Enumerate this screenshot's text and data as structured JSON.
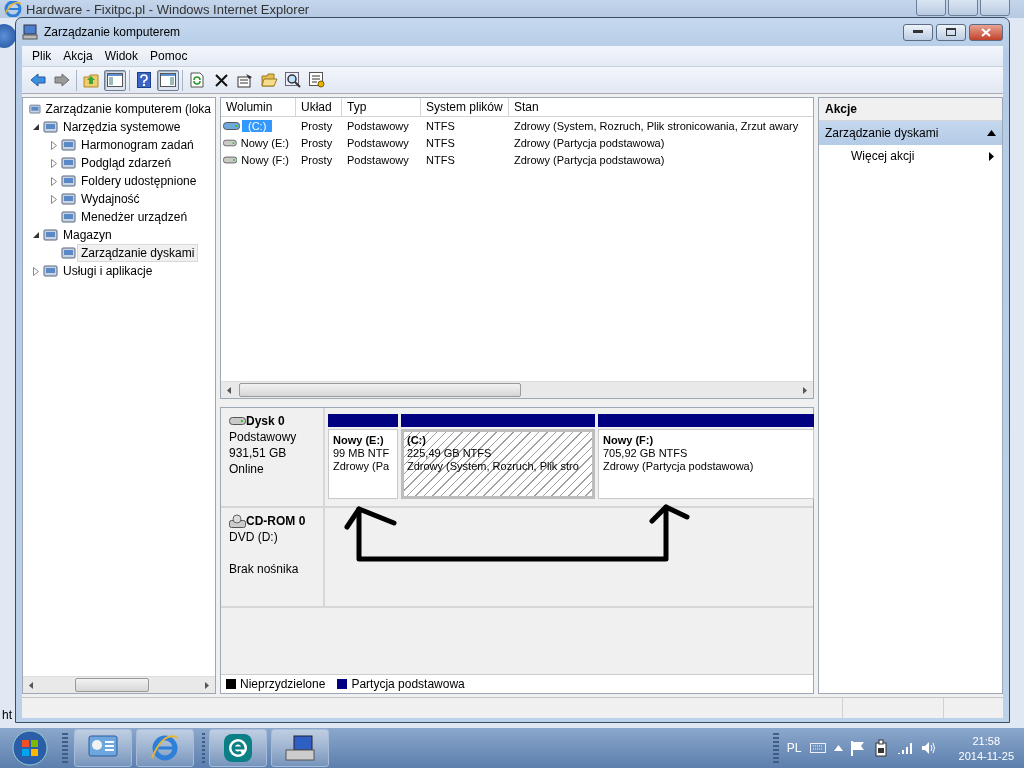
{
  "browser": {
    "title": "Hardware - Fixitpc.pl - Windows Internet Explorer",
    "status_text": "ht"
  },
  "window": {
    "title": "Zarządzanie komputerem"
  },
  "menu": [
    "Plik",
    "Akcja",
    "Widok",
    "Pomoc"
  ],
  "toolbar_groups": [
    {
      "buttons": [
        {
          "kind": "back",
          "pressed": false
        },
        {
          "kind": "forward",
          "pressed": false
        }
      ]
    },
    {
      "buttons": [
        {
          "kind": "up",
          "pressed": false
        },
        {
          "kind": "tree-pane",
          "pressed": true
        }
      ]
    },
    {
      "buttons": [
        {
          "kind": "help",
          "pressed": false
        },
        {
          "kind": "action-pane",
          "pressed": true
        }
      ]
    },
    {
      "buttons": [
        {
          "kind": "refresh",
          "pressed": false
        },
        {
          "kind": "delete",
          "pressed": false
        },
        {
          "kind": "properties",
          "pressed": false
        },
        {
          "kind": "open",
          "pressed": false
        },
        {
          "kind": "search",
          "pressed": false
        },
        {
          "kind": "settings",
          "pressed": false
        }
      ]
    }
  ],
  "tree": [
    {
      "label": "Zarządzanie komputerem (loka",
      "selected": false,
      "children": [
        {
          "label": "Narzędzia systemowe",
          "expanded": true,
          "selected": false,
          "children": [
            {
              "label": "Harmonogram zadań",
              "expanded": false,
              "selected": false
            },
            {
              "label": "Podgląd zdarzeń",
              "expanded": false,
              "selected": false
            },
            {
              "label": "Foldery udostępnione",
              "expanded": false,
              "selected": false
            },
            {
              "label": "Wydajność",
              "expanded": false,
              "selected": false
            },
            {
              "label": "Menedżer urządzeń",
              "selected": false
            }
          ]
        },
        {
          "label": "Magazyn",
          "expanded": true,
          "selected": false,
          "children": [
            {
              "label": "Zarządzanie dyskami",
              "selected": true
            }
          ]
        },
        {
          "label": "Usługi i aplikacje",
          "expanded": false,
          "selected": false
        }
      ]
    }
  ],
  "table": {
    "columns": [
      "Wolumin",
      "Układ",
      "Typ",
      "System plików",
      "Stan"
    ],
    "rows": [
      {
        "cells": [
          "(C:)",
          "Prosty",
          "Podstawowy",
          "NTFS",
          "Zdrowy (System, Rozruch, Plik stronicowania, Zrzut awary"
        ],
        "selected": true,
        "system": true
      },
      {
        "cells": [
          "Nowy (E:)",
          "Prosty",
          "Podstawowy",
          "NTFS",
          "Zdrowy (Partycja podstawowa)"
        ],
        "selected": false,
        "system": false
      },
      {
        "cells": [
          "Nowy (F:)",
          "Prosty",
          "Podstawowy",
          "NTFS",
          "Zdrowy (Partycja podstawowa)"
        ],
        "selected": false,
        "system": false
      }
    ]
  },
  "disks": [
    {
      "kind": "disk",
      "name": "Dysk 0",
      "lines": [
        "Podstawowy",
        "931,51 GB",
        "Online"
      ],
      "partitions": [
        {
          "name": "Nowy  (E:)",
          "size": "99 MB NTF",
          "status": "Zdrowy (Pa",
          "selected": false
        },
        {
          "name": "(C:)",
          "size": "225,49 GB NTFS",
          "status": "Zdrowy (System, Rozruch, Plik stro",
          "selected": true
        },
        {
          "name": "Nowy  (F:)",
          "size": "705,92 GB NTFS",
          "status": "Zdrowy (Partycja podstawowa)",
          "selected": false
        }
      ]
    },
    {
      "kind": "cdrom",
      "name": "CD-ROM 0",
      "lines": [
        "DVD (D:)"
      ],
      "media": "Brak nośnika"
    }
  ],
  "legend": [
    {
      "label": "Nieprzydzielone",
      "color": "#000000"
    },
    {
      "label": "Partycja podstawowa",
      "color": "#000080"
    }
  ],
  "actions": {
    "title": "Akcje",
    "sections": [
      {
        "label": "Zarządzanie dyskami",
        "expanded": true,
        "items": [
          "Więcej akcji"
        ]
      }
    ]
  },
  "taskbar": {
    "language": "PL",
    "time": "21:58",
    "date": "2014-11-25"
  }
}
